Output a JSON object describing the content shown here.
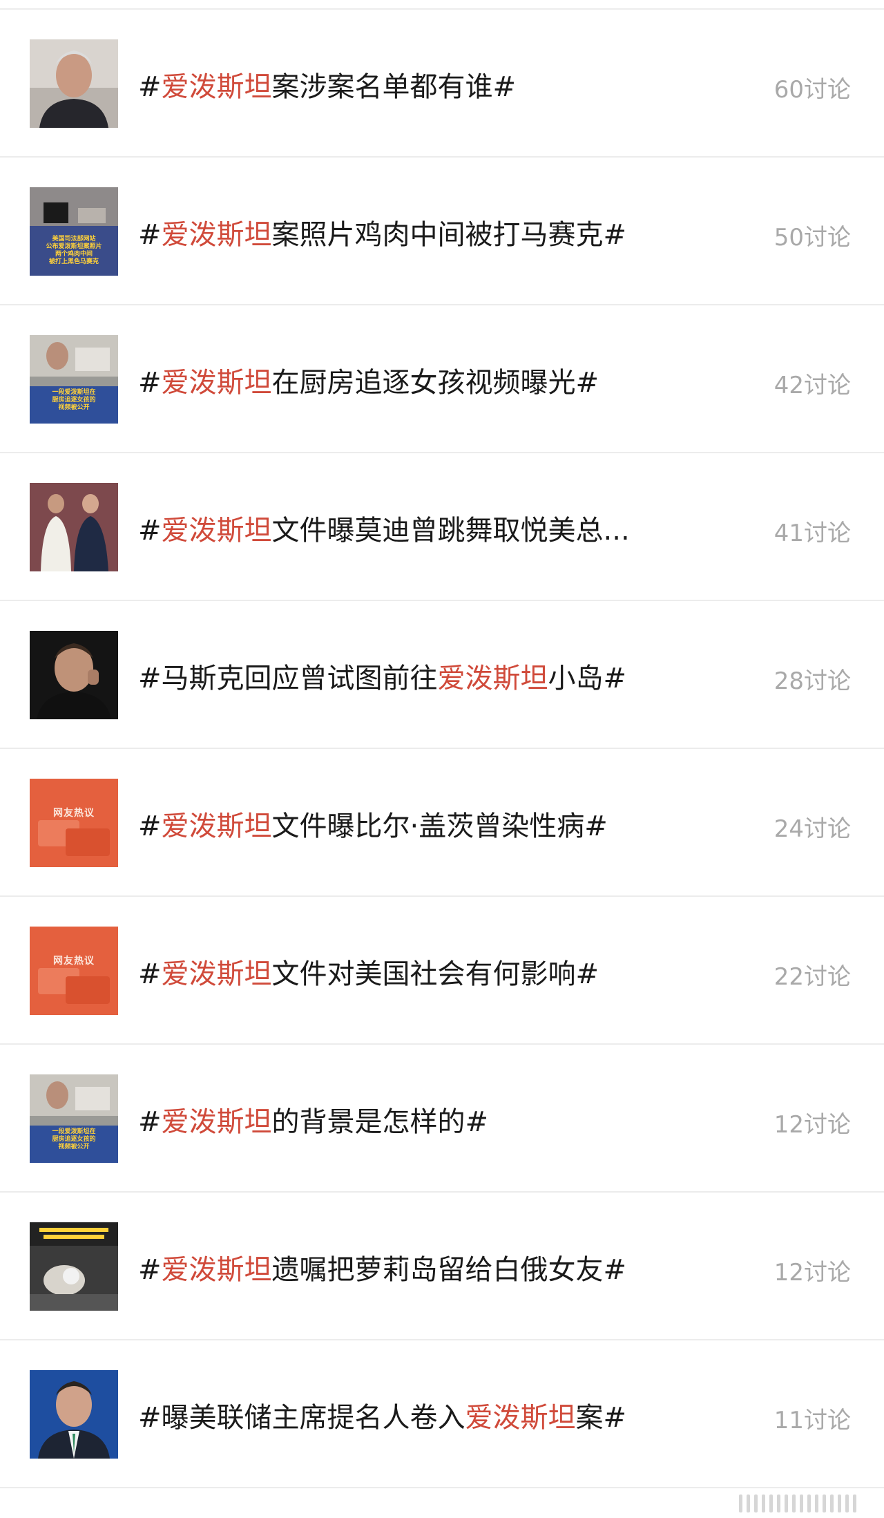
{
  "colors": {
    "highlight": "#d04a3a",
    "topic_text": "#1a1a1a",
    "count_text": "#a9a9a9",
    "divider": "#ececec"
  },
  "topics": [
    {
      "pre": "#",
      "hl": "爱泼斯坦",
      "post": "案涉案名单都有谁#",
      "count": "60讨论",
      "thumb": {
        "icon": "portrait-photo",
        "caption": ""
      }
    },
    {
      "pre": "#",
      "hl": "爱泼斯坦",
      "post": "案照片鸡肉中间被打马赛克#",
      "count": "50讨论",
      "thumb": {
        "icon": "news-photo",
        "caption": "美国司法部网站\n公布爱泼斯坦案照片\n两个鸡肉中间\n被打上黑色马赛克"
      }
    },
    {
      "pre": "#",
      "hl": "爱泼斯坦",
      "post": "在厨房追逐女孩视频曝光#",
      "count": "42讨论",
      "thumb": {
        "icon": "video-still",
        "caption": "一段爱泼斯坦在\n厨房追逐女孩的\n视频被公开"
      }
    },
    {
      "pre": "#",
      "hl": "爱泼斯坦",
      "post": "文件曝莫迪曾跳舞取悦美总...",
      "count": "41讨论",
      "thumb": {
        "icon": "two-people-photo",
        "caption": ""
      }
    },
    {
      "pre": "#马斯克回应曾试图前往",
      "hl": "爱泼斯坦",
      "post": "小岛#",
      "count": "28讨论",
      "thumb": {
        "icon": "portrait-photo",
        "caption": ""
      }
    },
    {
      "pre": "#",
      "hl": "爱泼斯坦",
      "post": "文件曝比尔·盖茨曾染性病#",
      "count": "24讨论",
      "thumb": {
        "icon": "netizen-discussion-card",
        "caption": "网友热议"
      }
    },
    {
      "pre": "#",
      "hl": "爱泼斯坦",
      "post": "文件对美国社会有何影响#",
      "count": "22讨论",
      "thumb": {
        "icon": "netizen-discussion-card",
        "caption": "网友热议"
      }
    },
    {
      "pre": "#",
      "hl": "爱泼斯坦",
      "post": "的背景是怎样的#",
      "count": "12讨论",
      "thumb": {
        "icon": "video-still",
        "caption": "一段爱泼斯坦在\n厨房追逐女孩的\n视频被公开"
      }
    },
    {
      "pre": "#",
      "hl": "爱泼斯坦",
      "post": "遗嘱把萝莉岛留给白俄女友#",
      "count": "12讨论",
      "thumb": {
        "icon": "news-photo",
        "caption": ""
      }
    },
    {
      "pre": "#曝美联储主席提名人卷入",
      "hl": "爱泼斯坦",
      "post": "案#",
      "count": "11讨论",
      "thumb": {
        "icon": "portrait-photo",
        "caption": ""
      }
    }
  ]
}
